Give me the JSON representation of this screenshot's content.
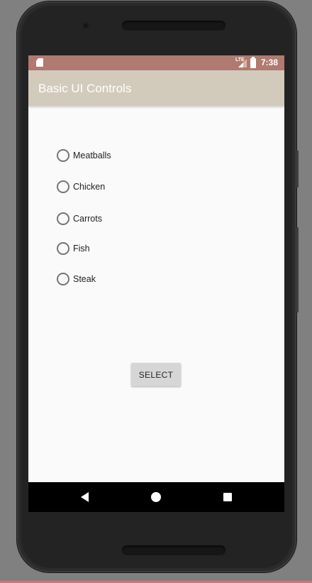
{
  "status_bar": {
    "network": "LTE",
    "time": "7:38",
    "color": "#b07a70"
  },
  "app_bar": {
    "title": "Basic UI Controls",
    "color": "#d2cbbc"
  },
  "radio_group": {
    "options": [
      {
        "label": "Meatballs",
        "selected": false
      },
      {
        "label": "Chicken",
        "selected": false
      },
      {
        "label": "Carrots",
        "selected": false
      },
      {
        "label": "Fish",
        "selected": false
      },
      {
        "label": "Steak",
        "selected": false
      }
    ]
  },
  "select_button": {
    "label": "SELECT"
  },
  "nav_bar": {
    "icons": [
      "back-icon",
      "home-icon",
      "recents-icon"
    ]
  }
}
